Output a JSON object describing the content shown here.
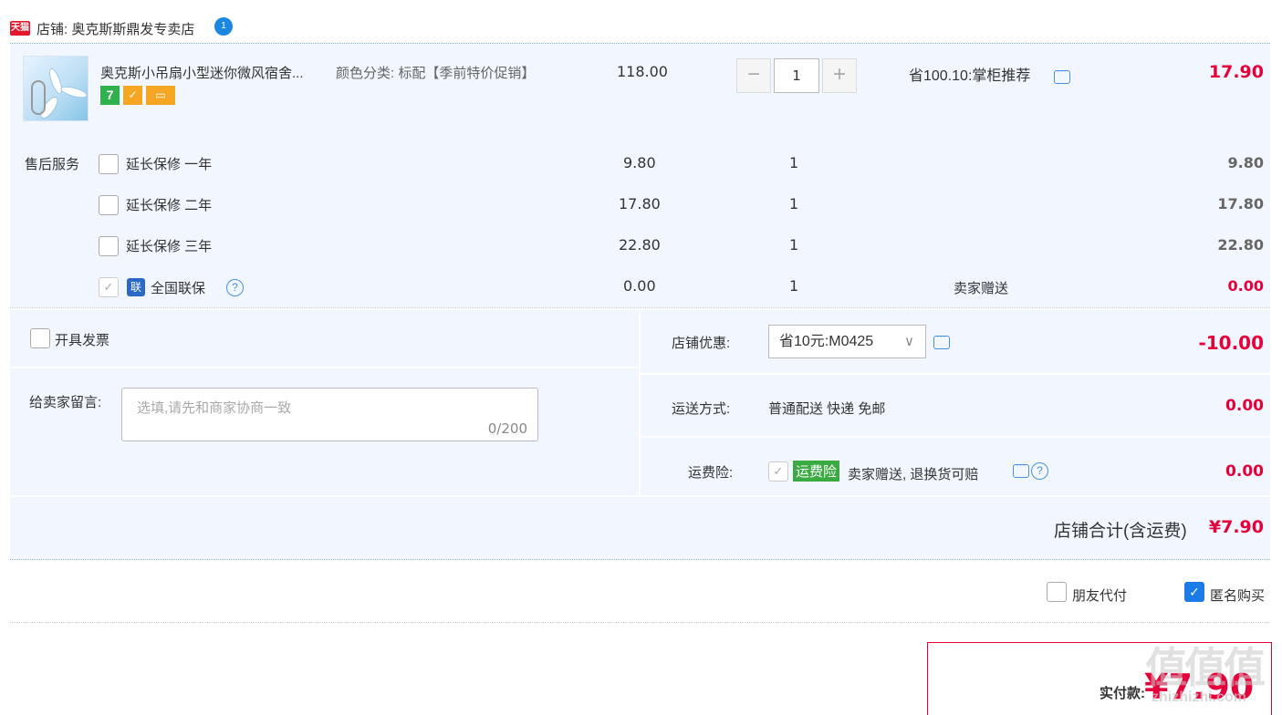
{
  "store": {
    "badge": "天猫",
    "label": "店铺: 奥克斯斯鼎发专卖店",
    "ww_icon": "1"
  },
  "item": {
    "title": "奥克斯小吊扇小型迷你微风宿舍...",
    "sku": "颜色分类: 标配【季前特价促销】",
    "price": "118.00",
    "quantity": "1",
    "minus": "−",
    "plus": "+",
    "promo": "省100.10:掌柜推荐",
    "subtotal": "17.90",
    "icons": [
      "7",
      "✓",
      "▭"
    ]
  },
  "service": {
    "label": "售后服务",
    "rows": [
      {
        "name": "延长保修 一年",
        "price": "9.80",
        "qty": "1",
        "note": "",
        "total": "9.80"
      },
      {
        "name": "延长保修 二年",
        "price": "17.80",
        "qty": "1",
        "note": "",
        "total": "17.80"
      },
      {
        "name": "延长保修 三年",
        "price": "22.80",
        "qty": "1",
        "note": "",
        "total": "22.80"
      },
      {
        "name": "全国联保",
        "price": "0.00",
        "qty": "1",
        "note": "卖家赠送",
        "total": "0.00"
      }
    ],
    "lian_icon": "联"
  },
  "invoice": {
    "label": "开具发票"
  },
  "message": {
    "label": "给卖家留言:",
    "placeholder": "选填,请先和商家协商一致",
    "counter": "0/200"
  },
  "discount": {
    "label": "店铺优惠:",
    "value": "省10元:M0425",
    "chevron": "∨",
    "amount": "-10.00"
  },
  "shipping": {
    "label": "运送方式:",
    "value": "普通配送 快递 免邮",
    "amount": "0.00"
  },
  "insurance": {
    "label": "运费险:",
    "badge": "运费险",
    "text": "卖家赠送, 退换货可赔",
    "amount": "0.00"
  },
  "store_total": {
    "label": "店铺合计(含运费)",
    "amount": "¥7.90"
  },
  "options": {
    "friend_pay": "朋友代付",
    "anonymous": "匿名购买"
  },
  "payment": {
    "label": "实付款:",
    "amount": "¥7.90"
  },
  "watermark": {
    "text": "值值值",
    "site": "zhizhizhi.com"
  },
  "colors": {
    "accent": "#e60039",
    "link": "#1b7be9",
    "panel": "#f2f7ff"
  }
}
